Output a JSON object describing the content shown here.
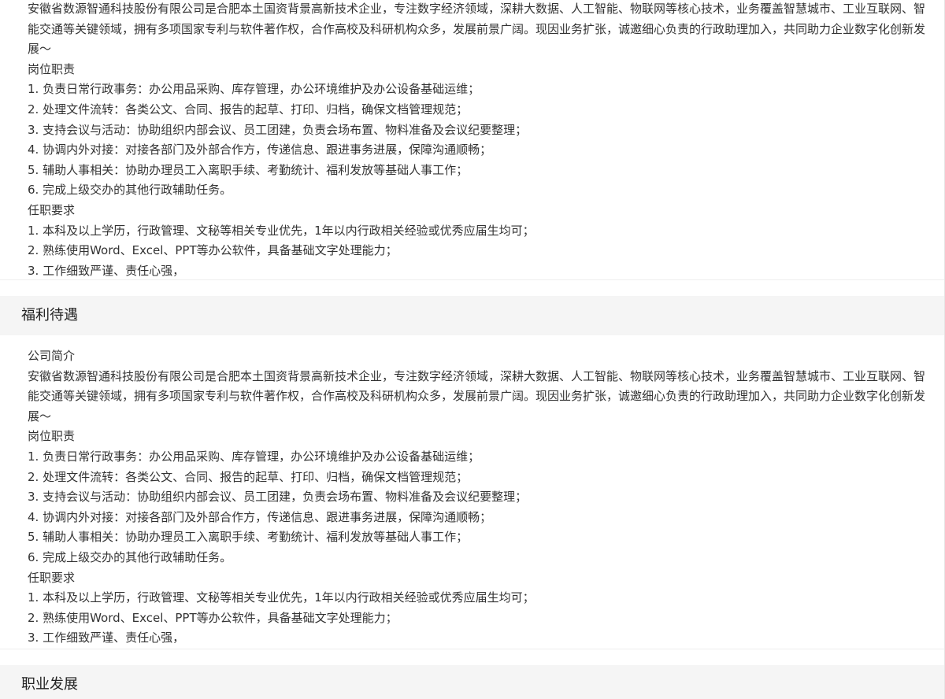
{
  "top_block": {
    "lines": [
      "安徽省数源智通科技股份有限公司是合肥本土国资背景高新技术企业，专注数字经济领域，深耕大数据、人工智能、物联网等核心技术，业务覆盖智慧城市、工业互联网、智能交通等关键领域，拥有多项国家专利与软件著作权，合作高校及科研机构众多，发展前景广阔。现因业务扩张，诚邀细心负责的行政助理加入，共同助力企业数字化创新发展～",
      "岗位职责",
      "1. 负责日常行政事务：办公用品采购、库存管理，办公环境维护及办公设备基础运维；",
      "2. 处理文件流转：各类公文、合同、报告的起草、打印、归档，确保文档管理规范；",
      "3. 支持会议与活动：协助组织内部会议、员工团建，负责会场布置、物料准备及会议纪要整理；",
      "4. 协调内外对接：对接各部门及外部合作方，传递信息、跟进事务进展，保障沟通顺畅；",
      "5. 辅助人事相关：协助办理员工入离职手续、考勤统计、福利发放等基础人事工作；",
      "6. 完成上级交办的其他行政辅助任务。",
      "任职要求",
      "1. 本科及以上学历，行政管理、文秘等相关专业优先，1年以内行政相关经验或优秀应届生均可；",
      "2. 熟练使用Word、Excel、PPT等办公软件，具备基础文字处理能力；",
      "3. 工作细致严谨、责任心强，"
    ]
  },
  "welfare_section": {
    "title": "福利待遇"
  },
  "mid_block": {
    "lines": [
      "公司简介",
      "安徽省数源智通科技股份有限公司是合肥本土国资背景高新技术企业，专注数字经济领域，深耕大数据、人工智能、物联网等核心技术，业务覆盖智慧城市、工业互联网、智能交通等关键领域，拥有多项国家专利与软件著作权，合作高校及科研机构众多，发展前景广阔。现因业务扩张，诚邀细心负责的行政助理加入，共同助力企业数字化创新发展～",
      "岗位职责",
      "1. 负责日常行政事务：办公用品采购、库存管理，办公环境维护及办公设备基础运维；",
      "2. 处理文件流转：各类公文、合同、报告的起草、打印、归档，确保文档管理规范；",
      "3. 支持会议与活动：协助组织内部会议、员工团建，负责会场布置、物料准备及会议纪要整理；",
      "4. 协调内外对接：对接各部门及外部合作方，传递信息、跟进事务进展，保障沟通顺畅；",
      "5. 辅助人事相关：协助办理员工入离职手续、考勤统计、福利发放等基础人事工作；",
      "6. 完成上级交办的其他行政辅助任务。",
      "任职要求",
      "1. 本科及以上学历，行政管理、文秘等相关专业优先，1年以内行政相关经验或优秀应届生均可；",
      "2. 熟练使用Word、Excel、PPT等办公软件，具备基础文字处理能力；",
      "3. 工作细致严谨、责任心强，"
    ]
  },
  "career_section": {
    "title": "职业发展"
  }
}
